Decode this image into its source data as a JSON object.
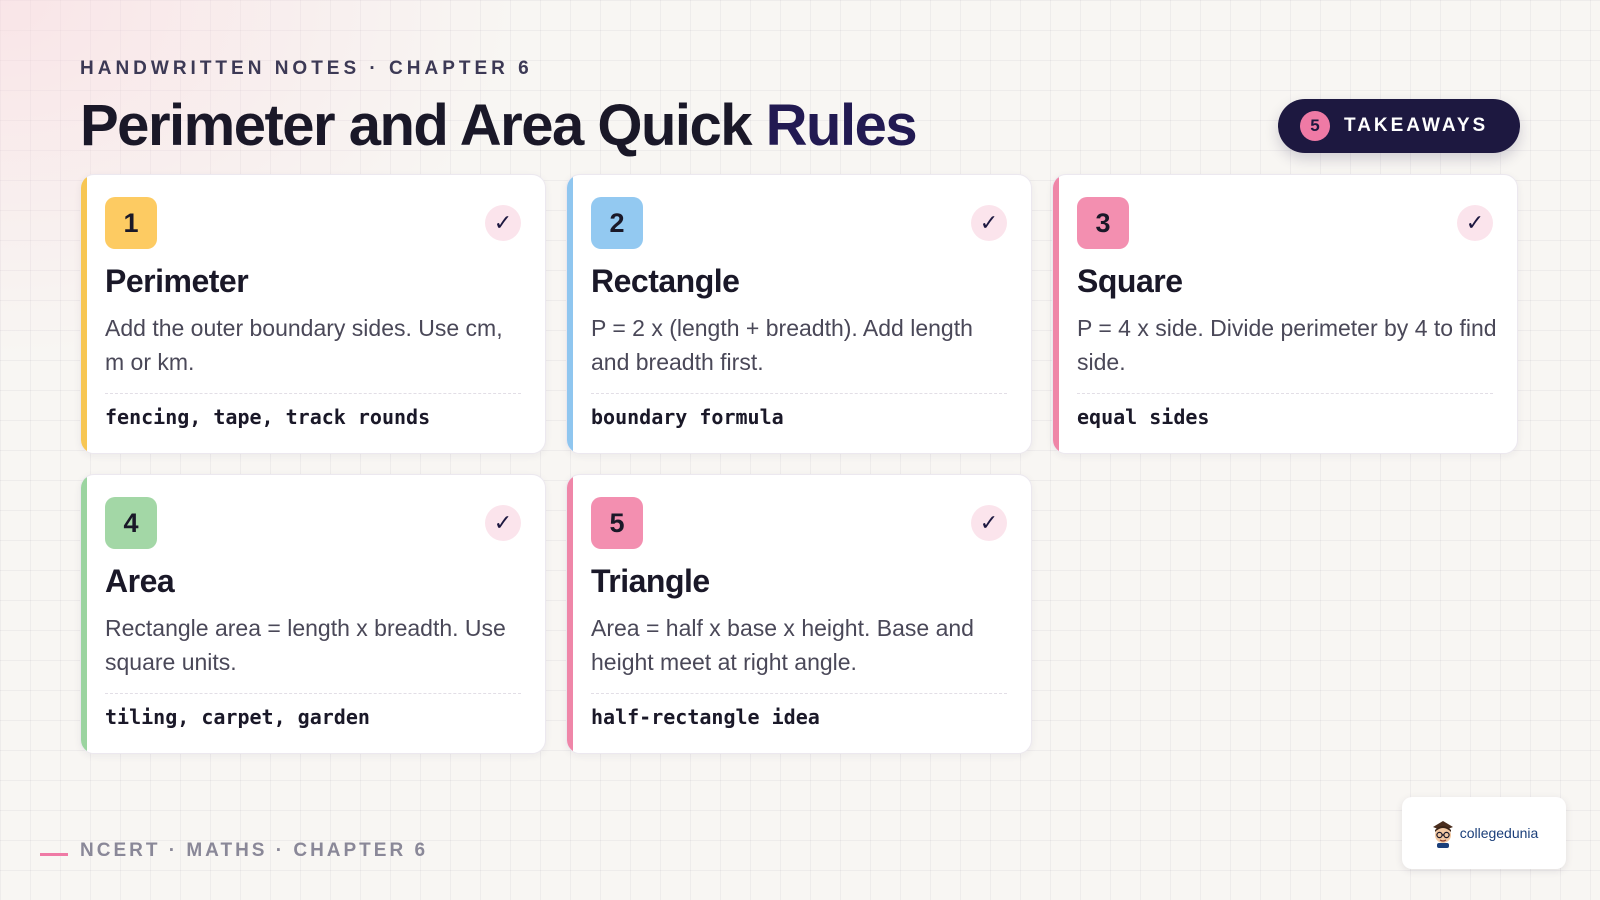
{
  "header": {
    "eyebrow": "HANDWRITTEN NOTES · CHAPTER 6",
    "title_main": "Perimeter and Area Quick",
    "title_accent": "Rules"
  },
  "badge": {
    "count": "5",
    "label": "TAKEAWAYS"
  },
  "check_glyph": "✓",
  "cards": [
    {
      "number": "1",
      "title": "Perimeter",
      "description": "Add the outer boundary sides. Use cm, m or km.",
      "tags": "fencing, tape, track rounds",
      "color": "#f7c653",
      "number_bg": "#fdcb62"
    },
    {
      "number": "2",
      "title": "Rectangle",
      "description": "P = 2 x (length + breadth). Add length and breadth first.",
      "tags": "boundary formula",
      "color": "#8fc6ef",
      "number_bg": "#93c9f1"
    },
    {
      "number": "3",
      "title": "Square",
      "description": "P = 4 x side. Divide perimeter by 4 to find side.",
      "tags": "equal sides",
      "color": "#ef86a8",
      "number_bg": "#f38fb0"
    },
    {
      "number": "4",
      "title": "Area",
      "description": "Rectangle area = length x breadth. Use square units.",
      "tags": "tiling, carpet, garden",
      "color": "#9bd4a0",
      "number_bg": "#a3d7a6"
    },
    {
      "number": "5",
      "title": "Triangle",
      "description": "Area = half x base x height. Base and height meet at right angle.",
      "tags": "half-rectangle idea",
      "color": "#ef86a8",
      "number_bg": "#f38fb0"
    }
  ],
  "footer": {
    "text": "NCERT · MATHS · CHAPTER 6"
  },
  "logo": {
    "text": "collegedunia",
    "icon": "student-mascot-icon"
  }
}
